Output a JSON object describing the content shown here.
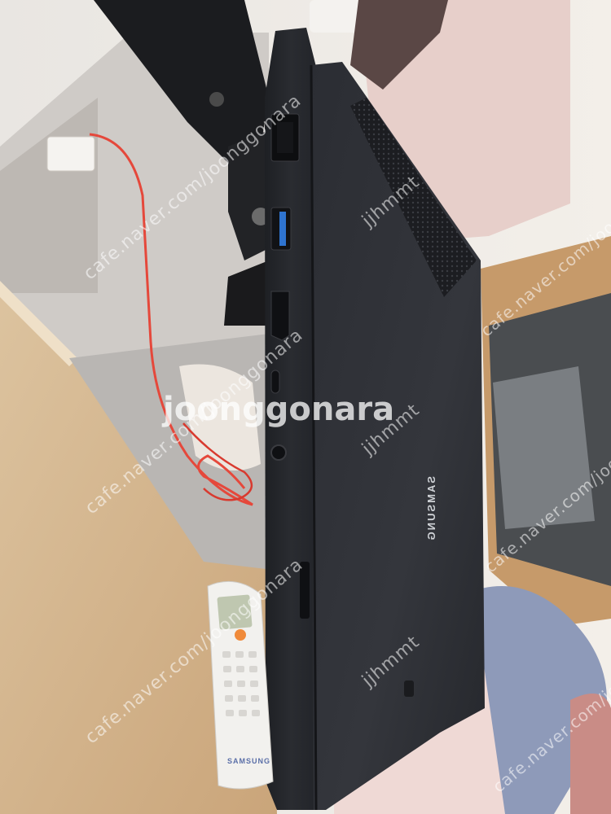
{
  "watermarks": {
    "site": "cafe.naver.com/joonggonara",
    "user": "jjhmmt",
    "center": "joonggonara"
  },
  "laptop": {
    "brand_text": "SAMSUNG",
    "ports": [
      "rj45-port",
      "usb-a-port",
      "hdmi-port",
      "usb-c-port",
      "audio-jack",
      "card-slot"
    ]
  },
  "remote": {
    "brand_text": "SAMSUNG"
  },
  "colors": {
    "laptop_body": "#26282d",
    "usb_accent": "#2f74d0",
    "cable": "#e5483b",
    "desk": "#d3b48e"
  }
}
